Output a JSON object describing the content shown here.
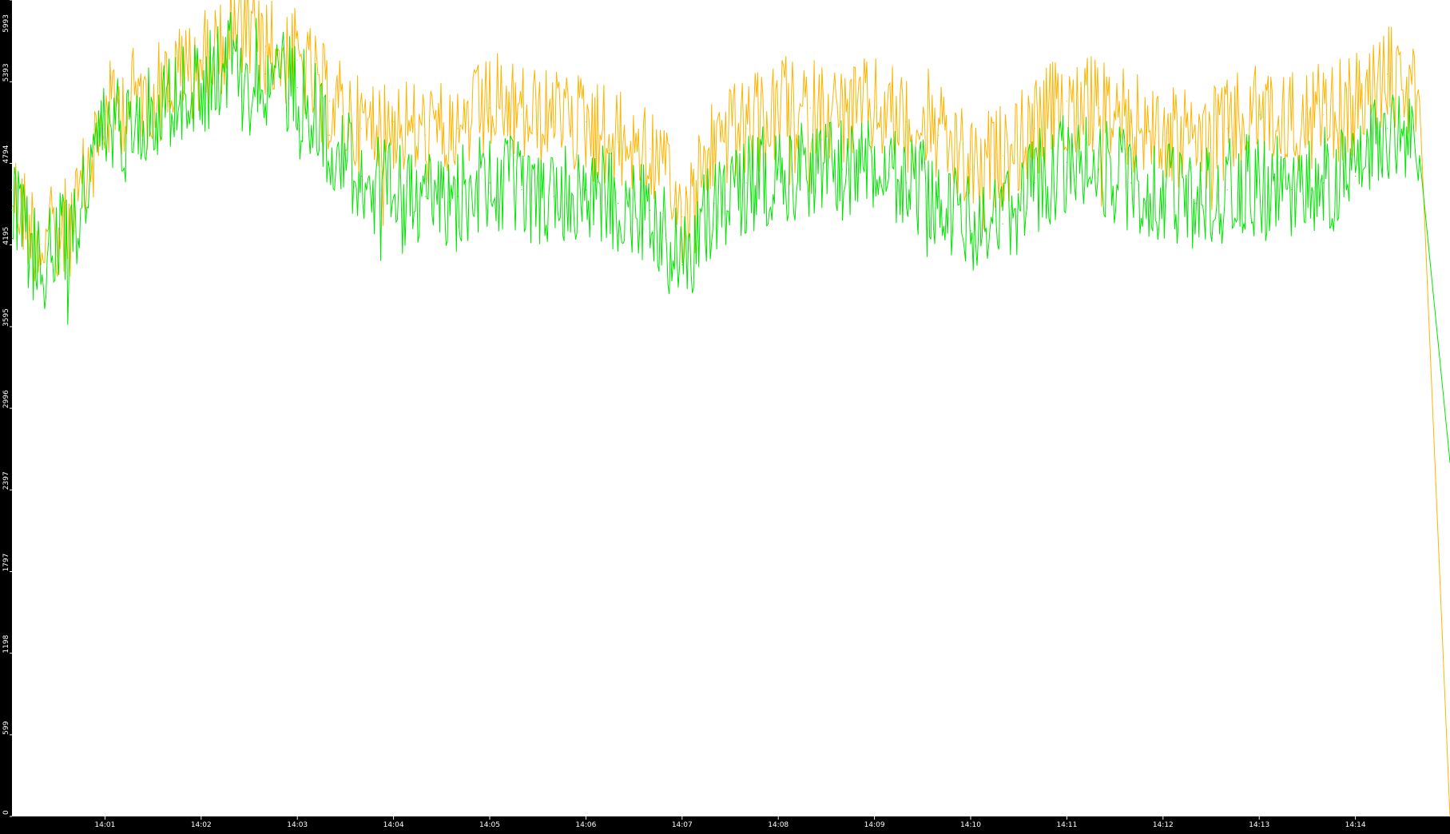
{
  "colors": {
    "background": "#ffffff",
    "frame": "#000000",
    "tick_text": "#ffffff",
    "series_orange": "#FFB400",
    "series_green": "#00E600"
  },
  "chart_data": {
    "type": "line",
    "title": "",
    "xlabel": "",
    "ylabel": "",
    "grid": false,
    "legend": "none",
    "x_range": [
      "14:00:02",
      "14:14:59"
    ],
    "ylim": [
      0,
      5993
    ],
    "yticks": [
      0,
      599,
      1198,
      1797,
      2397,
      2996,
      3595,
      4195,
      4794,
      5393,
      5993
    ],
    "xticks": [
      "14:01",
      "14:02",
      "14:03",
      "14:04",
      "14:05",
      "14:06",
      "14:07",
      "14:08",
      "14:09",
      "14:10",
      "14:11",
      "14:12",
      "14:13",
      "14:14"
    ],
    "series": [
      {
        "color": "#FFB400",
        "x": [
          "14:00:02",
          "14:00:20",
          "14:00:40",
          "14:01:00",
          "14:01:20",
          "14:01:40",
          "14:02:00",
          "14:02:20",
          "14:02:40",
          "14:03:00",
          "14:03:20",
          "14:03:40",
          "14:04:00",
          "14:04:20",
          "14:04:40",
          "14:05:00",
          "14:05:20",
          "14:05:40",
          "14:06:00",
          "14:06:20",
          "14:06:40",
          "14:07:00",
          "14:07:20",
          "14:07:40",
          "14:08:00",
          "14:08:20",
          "14:08:40",
          "14:09:00",
          "14:09:20",
          "14:09:40",
          "14:10:00",
          "14:10:20",
          "14:10:40",
          "14:11:00",
          "14:11:20",
          "14:11:40",
          "14:12:00",
          "14:12:20",
          "14:12:40",
          "14:13:00",
          "14:13:20",
          "14:13:40",
          "14:14:00",
          "14:14:20",
          "14:14:40",
          "14:14:59"
        ],
        "values": [
          4600,
          4200,
          4350,
          5150,
          5300,
          5400,
          5550,
          5750,
          5650,
          5550,
          5250,
          5050,
          5100,
          5000,
          5050,
          5200,
          5150,
          5100,
          5100,
          4950,
          4900,
          4400,
          4950,
          5050,
          5150,
          5200,
          5150,
          5200,
          5100,
          5000,
          4750,
          4850,
          5050,
          5250,
          5200,
          5100,
          5000,
          4950,
          5050,
          5150,
          5100,
          5150,
          5200,
          5450,
          5250,
          0
        ]
      },
      {
        "color": "#00E600",
        "x": [
          "14:00:02",
          "14:00:20",
          "14:00:40",
          "14:01:00",
          "14:01:20",
          "14:01:40",
          "14:02:00",
          "14:02:20",
          "14:02:40",
          "14:03:00",
          "14:03:20",
          "14:03:40",
          "14:04:00",
          "14:04:20",
          "14:04:40",
          "14:05:00",
          "14:05:20",
          "14:05:40",
          "14:06:00",
          "14:06:20",
          "14:06:40",
          "14:07:00",
          "14:07:20",
          "14:07:40",
          "14:08:00",
          "14:08:20",
          "14:08:40",
          "14:09:00",
          "14:09:20",
          "14:09:40",
          "14:10:00",
          "14:10:20",
          "14:10:40",
          "14:11:00",
          "14:11:20",
          "14:11:40",
          "14:12:00",
          "14:12:20",
          "14:12:40",
          "14:13:00",
          "14:13:20",
          "14:13:40",
          "14:14:00",
          "14:14:20",
          "14:14:40",
          "14:14:59"
        ],
        "values": [
          4450,
          4050,
          4300,
          5050,
          5150,
          5250,
          5350,
          5600,
          5450,
          5350,
          5000,
          4700,
          4550,
          4550,
          4550,
          4650,
          4600,
          4550,
          4600,
          4500,
          4450,
          4050,
          4500,
          4650,
          4750,
          4750,
          4750,
          4750,
          4650,
          4550,
          4300,
          4350,
          4650,
          4800,
          4750,
          4650,
          4600,
          4500,
          4600,
          4650,
          4600,
          4650,
          4700,
          5050,
          4850,
          2600
        ]
      }
    ]
  }
}
